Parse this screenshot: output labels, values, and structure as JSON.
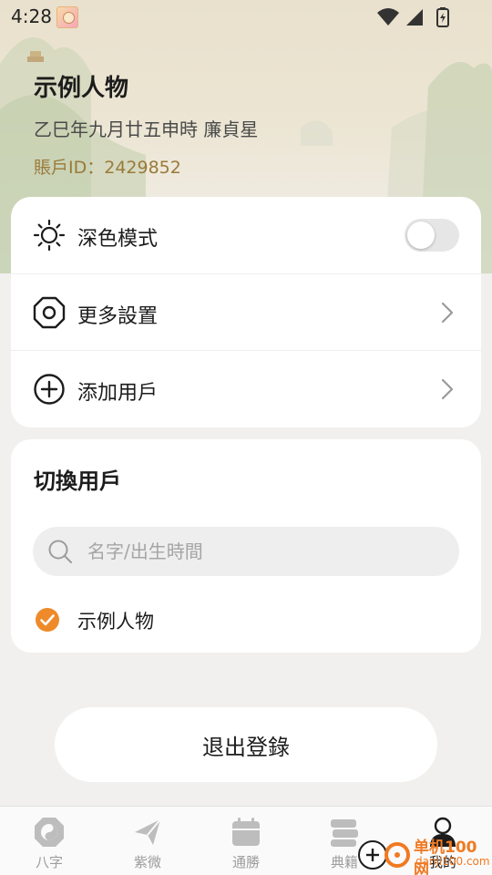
{
  "status_bar": {
    "time": "4:28"
  },
  "profile": {
    "name": "示例人物",
    "birth_info": "乙巳年九月廿五申時 廉貞星",
    "account_id": "賬戶ID：2429852"
  },
  "settings": {
    "dark_mode_label": "深色模式",
    "dark_mode_enabled": false,
    "more_settings_label": "更多設置",
    "add_user_label": "添加用戶"
  },
  "switch_user": {
    "title": "切換用戶",
    "search_placeholder": "名字/出生時間",
    "search_value": "",
    "users": [
      {
        "name": "示例人物",
        "selected": true
      }
    ]
  },
  "logout_label": "退出登錄",
  "bottom_nav": {
    "items": [
      {
        "label": "八字",
        "icon": "bazi-icon"
      },
      {
        "label": "紫微",
        "icon": "ziwei-icon"
      },
      {
        "label": "通勝",
        "icon": "calendar-icon"
      },
      {
        "label": "典籍",
        "icon": "books-icon"
      },
      {
        "label": "我的",
        "icon": "profile-icon",
        "active": true
      }
    ]
  },
  "watermark": {
    "text": "单机100网",
    "sub": "danji100.com"
  },
  "colors": {
    "accent": "#ee8a2a",
    "account_gold": "#9a7a39",
    "background": "#f1f0ee"
  }
}
